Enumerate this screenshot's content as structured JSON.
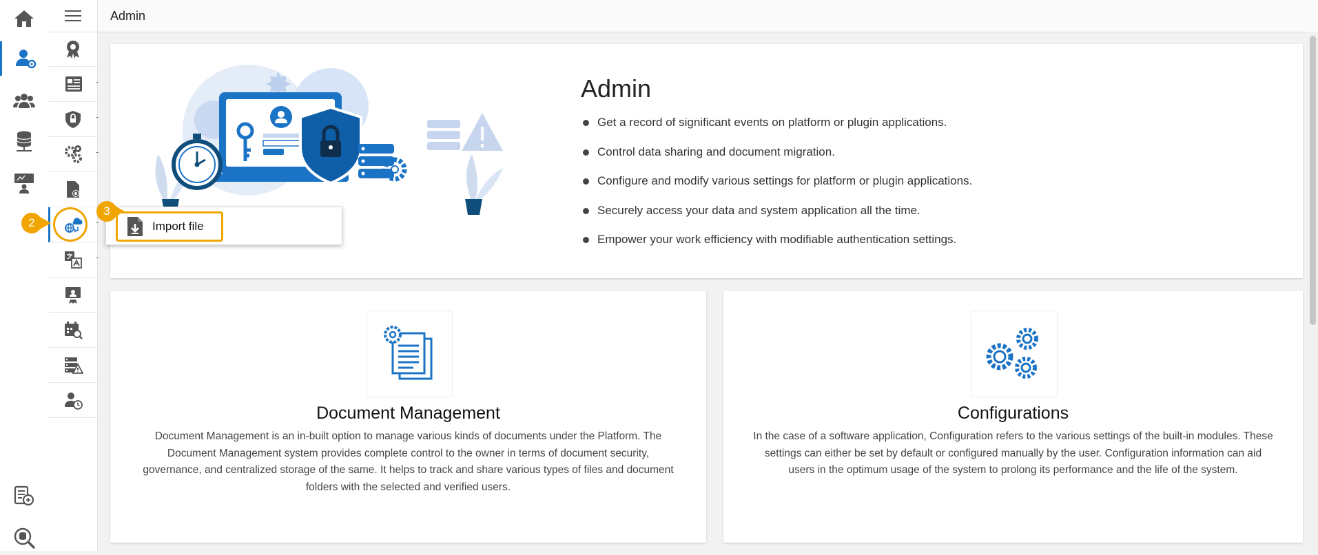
{
  "header": {
    "title": "Admin"
  },
  "hero": {
    "title": "Admin",
    "bullets": [
      "Get a record of significant events on platform or plugin applications.",
      "Control data sharing and document migration.",
      "Configure and modify various settings for platform or plugin applications.",
      "Securely access your data and system application all the time.",
      "Empower your work efficiency with modifiable authentication settings."
    ]
  },
  "cards": [
    {
      "title": "Document Management",
      "description": "Document Management is an in-built option to manage various kinds of documents under the Platform. The Document Management system provides complete control to the owner in terms of document security, governance, and centralized storage of the same. It helps to track and share various types of files and document folders with the selected and verified users."
    },
    {
      "title": "Configurations",
      "description": "In the case of a software application, Configuration refers to the various settings of the built-in modules. These settings can either be set by default or configured manually by the user. Configuration information can aid users in the optimum usage of the system to prolong its performance and the life of the system."
    }
  ],
  "popup": {
    "import_label": "Import file"
  },
  "badges": {
    "step2": "2",
    "step3": "3"
  },
  "rail": {
    "items": [
      "home-icon",
      "user-settings-icon",
      "users-group-icon",
      "database-icon",
      "monitor-user-icon"
    ],
    "bottom": [
      "data-report-icon",
      "database-search-icon"
    ]
  },
  "submenu": {
    "items": [
      "award-settings-icon",
      "news-list-icon",
      "shield-lock-icon",
      "gears-icon",
      "file-settings-icon",
      "cloud-migration-icon",
      "translate-icon",
      "certificate-user-icon",
      "calendar-search-icon",
      "server-warning-icon",
      "user-clock-icon"
    ]
  },
  "colors": {
    "accent": "#1b73c6",
    "highlight": "#f0a500",
    "icon_dark": "#555555"
  }
}
